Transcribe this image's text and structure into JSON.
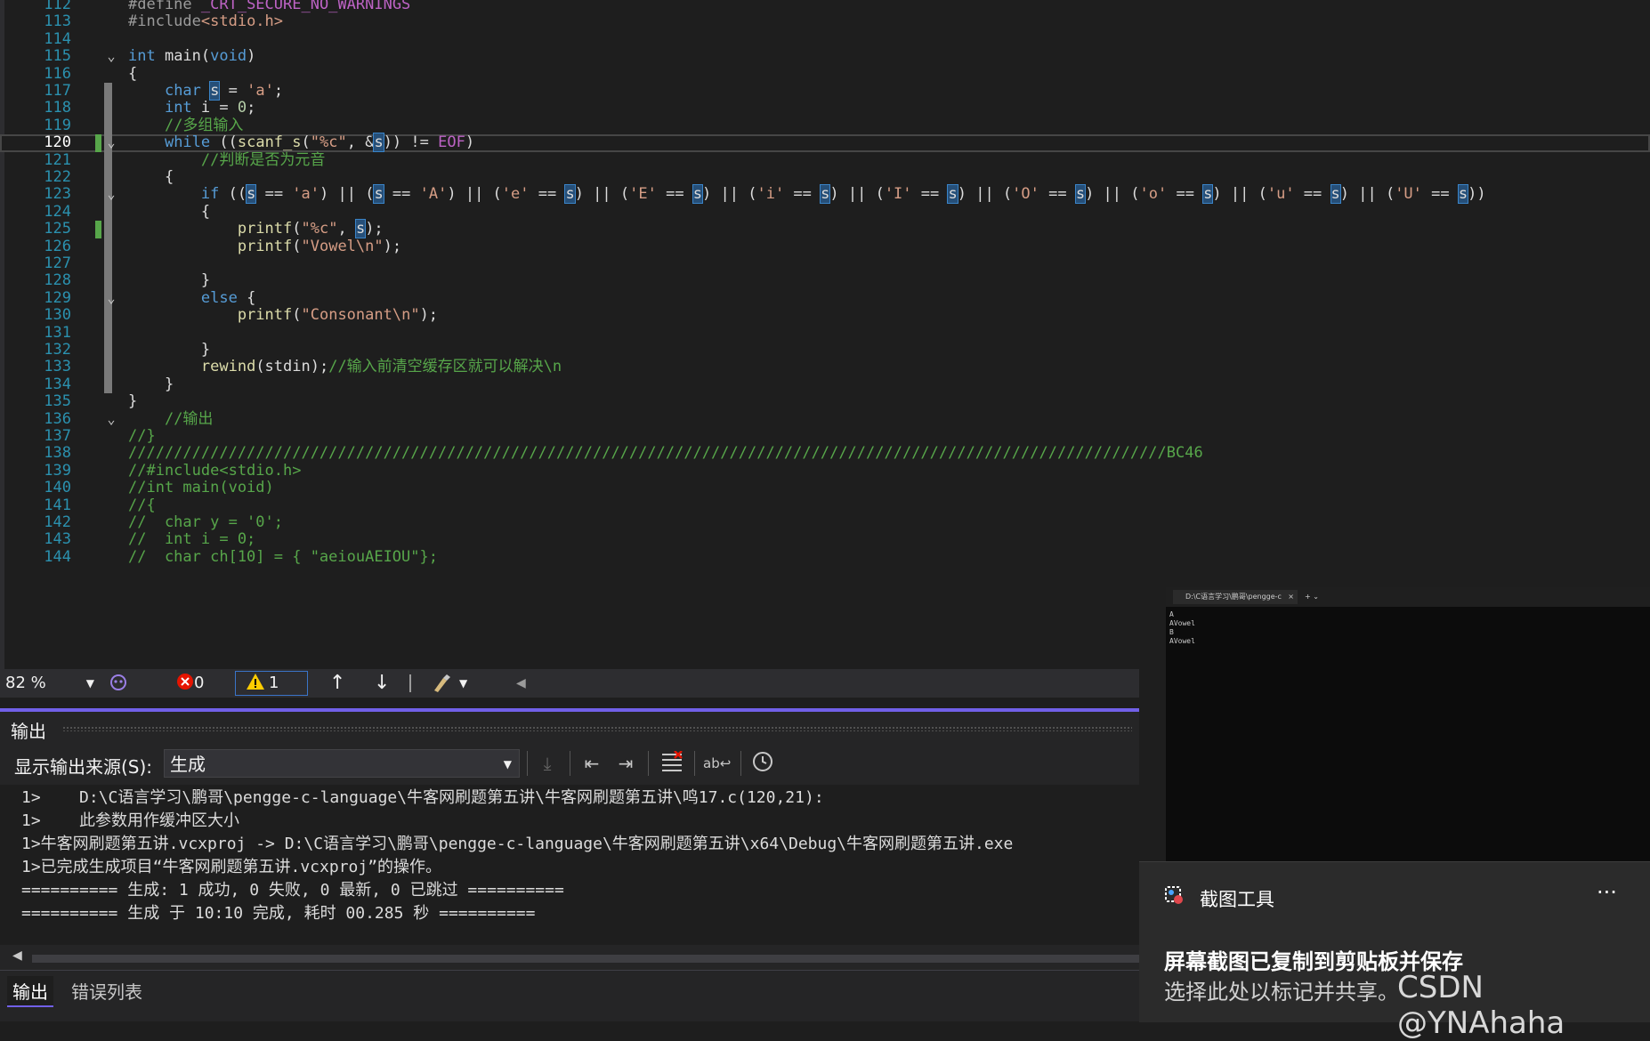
{
  "editor": {
    "zoom": "82 %",
    "error_count": "0",
    "warning_count": "1",
    "lines": [
      {
        "n": "112",
        "segments": [
          {
            "c": "pp",
            "t": "#define "
          },
          {
            "c": "mac",
            "t": "_CRT_SECURE_NO_WARNINGS"
          }
        ]
      },
      {
        "n": "113",
        "segments": [
          {
            "c": "pp",
            "t": "#include"
          },
          {
            "c": "str",
            "t": "<stdio.h>"
          }
        ]
      },
      {
        "n": "114",
        "segments": []
      },
      {
        "n": "115",
        "segments": [
          {
            "c": "kw",
            "t": "int"
          },
          {
            "c": "",
            "t": " main("
          },
          {
            "c": "kw",
            "t": "void"
          },
          {
            "c": "",
            "t": ")"
          }
        ]
      },
      {
        "n": "116",
        "segments": [
          {
            "c": "",
            "t": "{"
          }
        ]
      },
      {
        "n": "117",
        "segments": [
          {
            "c": "",
            "t": "    "
          },
          {
            "c": "kw",
            "t": "char"
          },
          {
            "c": "",
            "t": " "
          },
          {
            "c": "hl",
            "t": "s"
          },
          {
            "c": "",
            "t": " = "
          },
          {
            "c": "str",
            "t": "'a'"
          },
          {
            "c": "",
            "t": ";"
          }
        ]
      },
      {
        "n": "118",
        "segments": [
          {
            "c": "",
            "t": "    "
          },
          {
            "c": "kw",
            "t": "int"
          },
          {
            "c": "",
            "t": " i = "
          },
          {
            "c": "num",
            "t": "0"
          },
          {
            "c": "",
            "t": ";"
          }
        ]
      },
      {
        "n": "119",
        "segments": [
          {
            "c": "",
            "t": "    "
          },
          {
            "c": "cm",
            "t": "//多组输入"
          }
        ]
      },
      {
        "n": "120",
        "segments": [
          {
            "c": "",
            "t": "    "
          },
          {
            "c": "kw",
            "t": "while"
          },
          {
            "c": "",
            "t": " (("
          },
          {
            "c": "fn",
            "t": "scanf_s"
          },
          {
            "c": "",
            "t": "("
          },
          {
            "c": "str",
            "t": "\"%c\""
          },
          {
            "c": "",
            "t": ", &"
          },
          {
            "c": "hl",
            "t": "s"
          },
          {
            "c": "",
            "t": ")) != "
          },
          {
            "c": "mac",
            "t": "EOF"
          },
          {
            "c": "",
            "t": ")"
          }
        ]
      },
      {
        "n": "121",
        "segments": [
          {
            "c": "",
            "t": "        "
          },
          {
            "c": "cm",
            "t": "//判断是否为元音"
          }
        ]
      },
      {
        "n": "122",
        "segments": [
          {
            "c": "",
            "t": "    {"
          }
        ]
      },
      {
        "n": "123",
        "segments": [
          {
            "c": "",
            "t": "        "
          },
          {
            "c": "kw",
            "t": "if"
          },
          {
            "c": "",
            "t": " (("
          },
          {
            "c": "hl",
            "t": "s"
          },
          {
            "c": "",
            "t": " == "
          },
          {
            "c": "str",
            "t": "'a'"
          },
          {
            "c": "",
            "t": ") || ("
          },
          {
            "c": "hl",
            "t": "s"
          },
          {
            "c": "",
            "t": " == "
          },
          {
            "c": "str",
            "t": "'A'"
          },
          {
            "c": "",
            "t": ") || ("
          },
          {
            "c": "str",
            "t": "'e'"
          },
          {
            "c": "",
            "t": " == "
          },
          {
            "c": "hl",
            "t": "s"
          },
          {
            "c": "",
            "t": ") || ("
          },
          {
            "c": "str",
            "t": "'E'"
          },
          {
            "c": "",
            "t": " == "
          },
          {
            "c": "hl",
            "t": "s"
          },
          {
            "c": "",
            "t": ") || ("
          },
          {
            "c": "str",
            "t": "'i'"
          },
          {
            "c": "",
            "t": " == "
          },
          {
            "c": "hl",
            "t": "s"
          },
          {
            "c": "",
            "t": ") || ("
          },
          {
            "c": "str",
            "t": "'I'"
          },
          {
            "c": "",
            "t": " == "
          },
          {
            "c": "hl",
            "t": "s"
          },
          {
            "c": "",
            "t": ") || ("
          },
          {
            "c": "str",
            "t": "'O'"
          },
          {
            "c": "",
            "t": " == "
          },
          {
            "c": "hl",
            "t": "s"
          },
          {
            "c": "",
            "t": ") || ("
          },
          {
            "c": "str",
            "t": "'o'"
          },
          {
            "c": "",
            "t": " == "
          },
          {
            "c": "hl",
            "t": "s"
          },
          {
            "c": "",
            "t": ") || ("
          },
          {
            "c": "str",
            "t": "'u'"
          },
          {
            "c": "",
            "t": " == "
          },
          {
            "c": "hl",
            "t": "s"
          },
          {
            "c": "",
            "t": ") || ("
          },
          {
            "c": "str",
            "t": "'U'"
          },
          {
            "c": "",
            "t": " == "
          },
          {
            "c": "hl",
            "t": "s"
          },
          {
            "c": "",
            "t": "))"
          }
        ]
      },
      {
        "n": "124",
        "segments": [
          {
            "c": "",
            "t": "        {"
          }
        ]
      },
      {
        "n": "125",
        "segments": [
          {
            "c": "",
            "t": "            "
          },
          {
            "c": "fn",
            "t": "printf"
          },
          {
            "c": "",
            "t": "("
          },
          {
            "c": "str",
            "t": "\"%c\""
          },
          {
            "c": "",
            "t": ", "
          },
          {
            "c": "hl",
            "t": "s"
          },
          {
            "c": "",
            "t": ");"
          }
        ]
      },
      {
        "n": "126",
        "segments": [
          {
            "c": "",
            "t": "            "
          },
          {
            "c": "fn",
            "t": "printf"
          },
          {
            "c": "",
            "t": "("
          },
          {
            "c": "str",
            "t": "\"Vowel\\n\""
          },
          {
            "c": "",
            "t": ");"
          }
        ]
      },
      {
        "n": "127",
        "segments": []
      },
      {
        "n": "128",
        "segments": [
          {
            "c": "",
            "t": "        }"
          }
        ]
      },
      {
        "n": "129",
        "segments": [
          {
            "c": "",
            "t": "        "
          },
          {
            "c": "kw",
            "t": "else"
          },
          {
            "c": "",
            "t": " {"
          }
        ]
      },
      {
        "n": "130",
        "segments": [
          {
            "c": "",
            "t": "            "
          },
          {
            "c": "fn",
            "t": "printf"
          },
          {
            "c": "",
            "t": "("
          },
          {
            "c": "str",
            "t": "\"Consonant\\n\""
          },
          {
            "c": "",
            "t": ");"
          }
        ]
      },
      {
        "n": "131",
        "segments": []
      },
      {
        "n": "132",
        "segments": [
          {
            "c": "",
            "t": "        }"
          }
        ]
      },
      {
        "n": "133",
        "segments": [
          {
            "c": "",
            "t": "        "
          },
          {
            "c": "fn",
            "t": "rewind"
          },
          {
            "c": "",
            "t": "(stdin);"
          },
          {
            "c": "cm",
            "t": "//输入前清空缓存区就可以解决\\n"
          }
        ]
      },
      {
        "n": "134",
        "segments": [
          {
            "c": "",
            "t": "    }"
          }
        ]
      },
      {
        "n": "135",
        "segments": [
          {
            "c": "",
            "t": "}"
          }
        ]
      },
      {
        "n": "136",
        "segments": [
          {
            "c": "",
            "t": "    "
          },
          {
            "c": "cm",
            "t": "//输出"
          }
        ]
      },
      {
        "n": "137",
        "segments": [
          {
            "c": "cm",
            "t": "//}"
          }
        ]
      },
      {
        "n": "138",
        "segments": [
          {
            "c": "cm",
            "t": "//////////////////////////////////////////////////////////////////////////////////////////////////////////////////BC46"
          }
        ]
      },
      {
        "n": "139",
        "segments": [
          {
            "c": "cm",
            "t": "//#include<stdio.h>"
          }
        ]
      },
      {
        "n": "140",
        "segments": [
          {
            "c": "cm",
            "t": "//int main(void)"
          }
        ]
      },
      {
        "n": "141",
        "segments": [
          {
            "c": "cm",
            "t": "//{"
          }
        ]
      },
      {
        "n": "142",
        "segments": [
          {
            "c": "cm",
            "t": "//  char y = '0';"
          }
        ]
      },
      {
        "n": "143",
        "segments": [
          {
            "c": "cm",
            "t": "//  int i = 0;"
          }
        ]
      },
      {
        "n": "144",
        "segments": [
          {
            "c": "cm",
            "t": "//  char ch[10] = { \"aeiouAEIOU\"};"
          }
        ]
      }
    ]
  },
  "output": {
    "title": "输出",
    "source_label": "显示输出来源(S):",
    "source_value": "生成",
    "lines": [
      "1>    D:\\C语言学习\\鹏哥\\pengge-c-language\\牛客网刷题第五讲\\牛客网刷题第五讲\\鸣17.c(120,21):",
      "1>    此参数用作缓冲区大小",
      "1>牛客网刷题第五讲.vcxproj -> D:\\C语言学习\\鹏哥\\pengge-c-language\\牛客网刷题第五讲\\x64\\Debug\\牛客网刷题第五讲.exe",
      "1>已完成生成项目“牛客网刷题第五讲.vcxproj”的操作。",
      "========== 生成: 1 成功, 0 失败, 0 最新, 0 已跳过 ==========",
      "========== 生成 于 10:10 完成, 耗时 00.285 秒 =========="
    ],
    "tabs": [
      "输出",
      "错误列表"
    ]
  },
  "console": {
    "tab_title": "D:\\C语言学习\\鹏哥\\pengge-c",
    "lines": [
      "A",
      "AVowel",
      "B",
      "AVowel"
    ]
  },
  "toast": {
    "app_name": "截图工具",
    "more": "···",
    "title": "屏幕截图已复制到剪贴板并保存",
    "body": "选择此处以标记并共享。"
  },
  "watermark": "CSDN @YNAhaha",
  "colors": {
    "accent": "#7160e8",
    "keyword": "#569cd6",
    "comment": "#57a64a",
    "string": "#d69d85"
  }
}
